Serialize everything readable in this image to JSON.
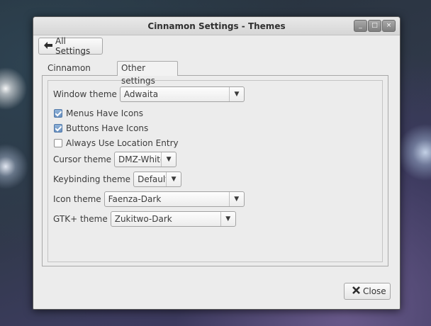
{
  "window": {
    "title": "Cinnamon Settings - Themes",
    "buttons": {
      "minimize": "_",
      "maximize": "□",
      "close": "×"
    }
  },
  "toolbar": {
    "all_settings_label": "All Settings",
    "back_icon": "back-arrow-icon"
  },
  "tabs": [
    {
      "label": "Cinnamon themes",
      "active": false
    },
    {
      "label": "Other settings",
      "active": true
    }
  ],
  "settings": {
    "window_theme": {
      "label": "Window theme",
      "value": "Adwaita"
    },
    "checkboxes": [
      {
        "label": "Menus Have Icons",
        "checked": true
      },
      {
        "label": "Buttons Have Icons",
        "checked": true
      },
      {
        "label": "Always Use Location Entry",
        "checked": false
      }
    ],
    "cursor_theme": {
      "label": "Cursor theme",
      "value": "DMZ-White"
    },
    "keybinding_theme": {
      "label": "Keybinding theme",
      "value": "Default"
    },
    "icon_theme": {
      "label": "Icon theme",
      "value": "Faenza-Dark"
    },
    "gtk_theme": {
      "label": "GTK+ theme",
      "value": "Zukitwo-Dark"
    }
  },
  "footer": {
    "close_label": "Close"
  }
}
